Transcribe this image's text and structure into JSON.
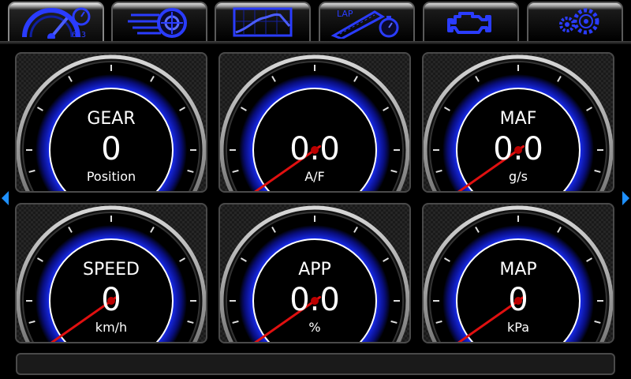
{
  "tabs": [
    {
      "name": "dashboard",
      "icon": "speedometer-stopwatch-icon",
      "active": true
    },
    {
      "name": "performance",
      "icon": "turbo-icon",
      "active": false
    },
    {
      "name": "dyno",
      "icon": "graph-icon",
      "active": false
    },
    {
      "name": "lap-timer",
      "icon": "lap-track-icon",
      "active": false
    },
    {
      "name": "diagnostics",
      "icon": "check-engine-icon",
      "active": false
    },
    {
      "name": "settings",
      "icon": "gears-icon",
      "active": false
    }
  ],
  "lap_icon_text": "LAP",
  "gauges": [
    {
      "title": "GEAR",
      "value": "0",
      "unit": "Position",
      "needle": false
    },
    {
      "title": "",
      "value": "0.0",
      "unit": "A/F",
      "needle": true
    },
    {
      "title": "MAF",
      "value": "0.0",
      "unit": "g/s",
      "needle": true
    },
    {
      "title": "SPEED",
      "value": "0",
      "unit": "km/h",
      "needle": true
    },
    {
      "title": "APP",
      "value": "0.0",
      "unit": "%",
      "needle": true
    },
    {
      "title": "MAP",
      "value": "0",
      "unit": "kPa",
      "needle": true
    }
  ],
  "colors": {
    "accent_blue": "#1e3cff",
    "needle_red": "#e01010",
    "arrow_blue": "#1e90ff"
  }
}
